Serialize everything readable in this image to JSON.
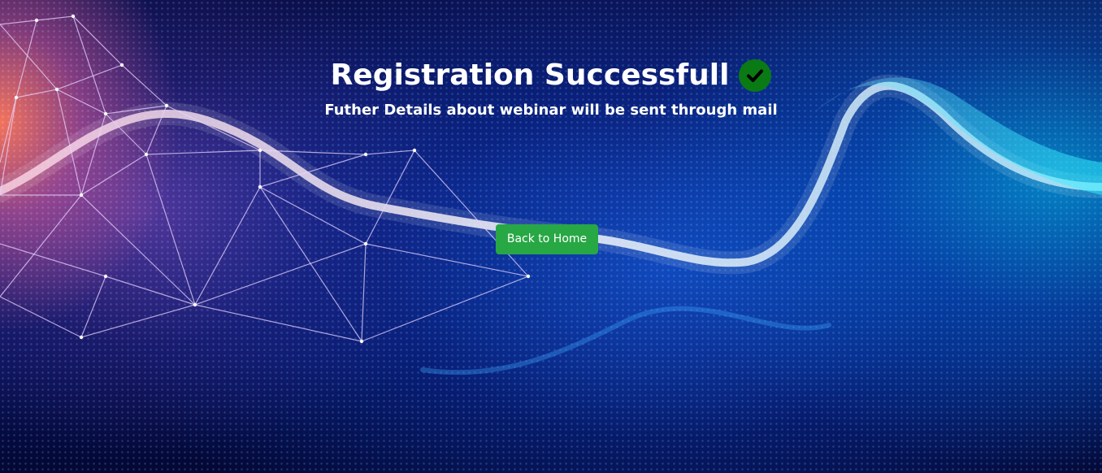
{
  "page": {
    "title": "Registration Successfull",
    "subtitle": "Futher Details about webinar will be sent through mail",
    "back_button_label": "Back to Home"
  },
  "icons": {
    "title_status": "check-circle-icon"
  },
  "colors": {
    "button_bg": "#28a745",
    "check_bg": "#0a7a14",
    "text": "#ffffff",
    "background_dark": "#0a1a6e"
  }
}
